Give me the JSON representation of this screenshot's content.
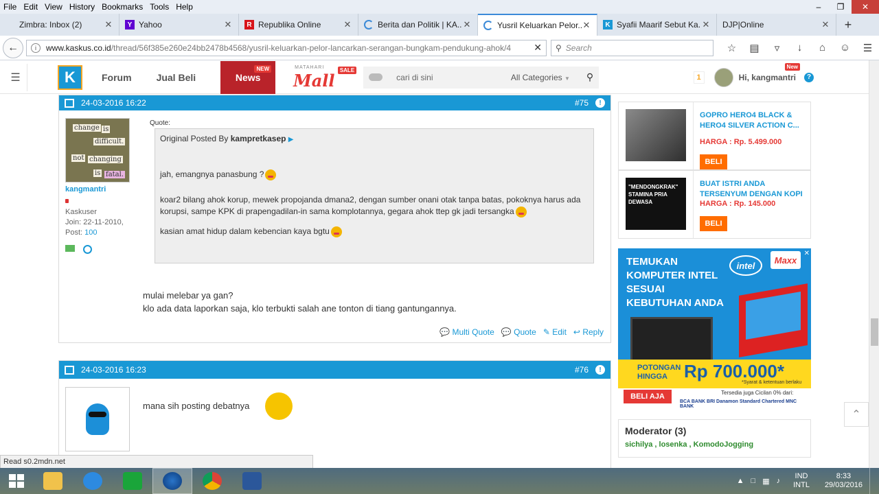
{
  "menu": [
    "File",
    "Edit",
    "View",
    "History",
    "Bookmarks",
    "Tools",
    "Help"
  ],
  "tabs": [
    {
      "title": "Zimbra: Inbox (2)",
      "icon": "zimbra-icon",
      "color": "#ffffff"
    },
    {
      "title": "Yahoo",
      "icon": "yahoo-icon",
      "color": "#5f01d1"
    },
    {
      "title": "Republika Online",
      "icon": "republika-icon",
      "color": "#d7141a"
    },
    {
      "title": "Berita dan Politik | KA...",
      "icon": "loading-icon",
      "color": "#3b8ad8"
    },
    {
      "title": "Yusril Keluarkan Pelor...",
      "icon": "loading-icon",
      "color": "#3b8ad8"
    },
    {
      "title": "Syafii Maarif Sebut Ka...",
      "icon": "kaskus-icon",
      "color": "#1998d5"
    },
    {
      "title": "DJP|Online",
      "icon": "blank-icon",
      "color": "#ffffff"
    }
  ],
  "url": {
    "domain": "www.kaskus.co.id",
    "path": "/thread/56f385e260e24bb2478b4568/yusril-keluarkan-pelor-lancarkan-serangan-bungkam-pendukung-ahok/4"
  },
  "search_placeholder": "Search",
  "kaskus": {
    "nav_forum": "Forum",
    "nav_jualbeli": "Jual Beli",
    "nav_news": "News",
    "badge_new": "NEW",
    "mall_top": "MATAHARI",
    "mall_name": "Mall",
    "mall_sale": "SALE",
    "search_placeholder": "cari di sini",
    "category": "All Categories",
    "notif_count": "1",
    "greeting": "Hi, kangmantri",
    "greeting_badge": "New"
  },
  "posts": [
    {
      "date": "24-03-2016 16:22",
      "number": "#75",
      "username": "kangmantri",
      "rank": "Kaskuser",
      "join_label": "Join: 22-11-2010,",
      "post_label": "Post:",
      "post_count": "100",
      "avatar_words": [
        "change",
        "is",
        "difficult.",
        "not",
        "changing",
        "is",
        "fatal."
      ],
      "quote_label": "Quote:",
      "quote_prefix": "Original Posted By",
      "quote_author": "kampretkasep",
      "quote_lines": [
        "jah, emangnya panasbung ?",
        "koar2 bilang ahok korup, mewek propojanda dmana2, dengan sumber onani otak tanpa batas, pokoknya harus ada korupsi, sampe KPK di prapengadilan-in sama komplotannya, gegara ahok ttep gk jadi tersangka",
        "kasian amat hidup dalam kebencian kaya bgtu"
      ],
      "body_lines": [
        "mulai melebar ya gan?",
        "klo ada data laporkan saja, klo terbukti salah ane tonton di tiang gantungannya."
      ],
      "actions": [
        "Multi Quote",
        "Quote",
        "Edit",
        "Reply"
      ]
    },
    {
      "date": "24-03-2016 16:23",
      "number": "#76",
      "body": "mana sih posting debatnya"
    }
  ],
  "products": [
    {
      "title": "GOPRO HERO4 BLACK & HERO4 SILVER ACTION C...",
      "price": "HARGA : Rp. 5.499.000",
      "button": "BELI",
      "thumb_text": ""
    },
    {
      "title": "BUAT ISTRI ANDA TERSENYUM DENGAN KOPI",
      "price": "HARGA : Rp. 145.000",
      "button": "BELI",
      "thumb_text": "\"MENDONGKRAK\" STAMINA PRIA DEWASA"
    }
  ],
  "ad": {
    "headline": "TEMUKAN KOMPUTER INTEL SESUAI KEBUTUHAN ANDA",
    "intel": "intel",
    "maxi": "Maxx",
    "potongan": "POTONGAN HINGGA",
    "amount": "Rp 700.000*",
    "syarat": "*Syarat & ketentuan berlaku",
    "beli": "BELI AJA",
    "cicilan": "Tersedia juga Cicilan 0% dari:",
    "banks": "BCA  BANK BRI  Danamon  Standard Chartered  MNC BANK"
  },
  "moderator": {
    "title": "Moderator (3)",
    "names": "sichilya , losenka , KomodoJogging"
  },
  "status_text": "Read s0.2mdn.net",
  "tray": {
    "lang1": "IND",
    "lang2": "INTL",
    "time": "8:33",
    "date": "29/03/2016"
  },
  "colors": {
    "kaskus_blue": "#1998d5",
    "news_red": "#b9232a",
    "beli_orange": "#ff6d00"
  }
}
